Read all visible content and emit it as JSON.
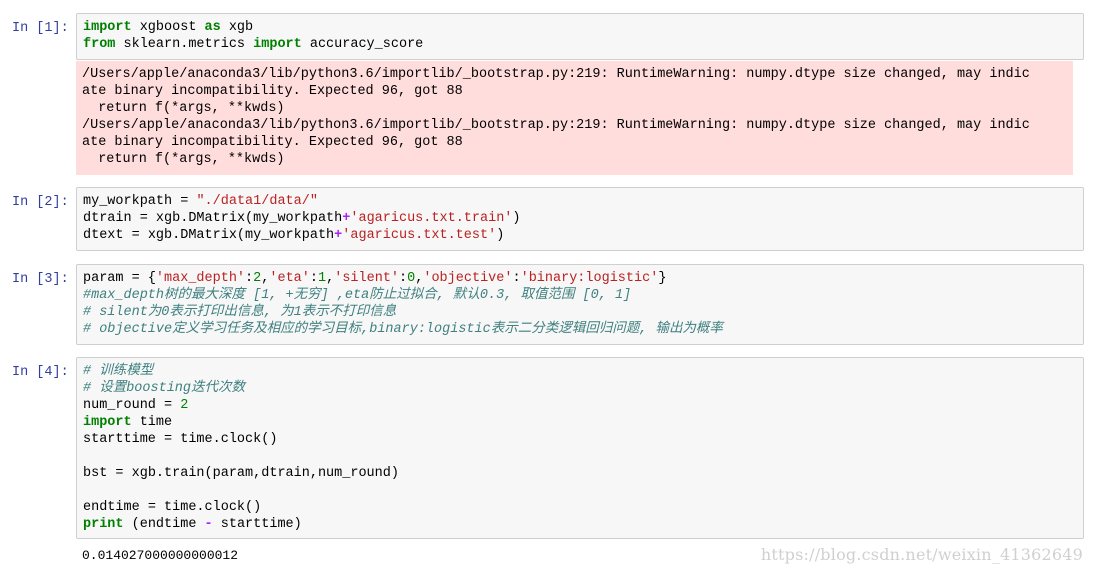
{
  "cells": [
    {
      "prompt": "In [1]:",
      "lines": [
        [
          {
            "t": "import",
            "c": "kw"
          },
          {
            "t": " xgboost ",
            "c": ""
          },
          {
            "t": "as",
            "c": "kw"
          },
          {
            "t": " xgb",
            "c": ""
          }
        ],
        [
          {
            "t": "from",
            "c": "kw"
          },
          {
            "t": " sklearn.metrics ",
            "c": ""
          },
          {
            "t": "import",
            "c": "kw"
          },
          {
            "t": " accuracy_score",
            "c": ""
          }
        ]
      ],
      "stderr": [
        "/Users/apple/anaconda3/lib/python3.6/importlib/_bootstrap.py:219: RuntimeWarning: numpy.dtype size changed, may indic",
        "ate binary incompatibility. Expected 96, got 88",
        "  return f(*args, **kwds)",
        "/Users/apple/anaconda3/lib/python3.6/importlib/_bootstrap.py:219: RuntimeWarning: numpy.dtype size changed, may indic",
        "ate binary incompatibility. Expected 96, got 88",
        "  return f(*args, **kwds)"
      ]
    },
    {
      "prompt": "In [2]:",
      "lines": [
        [
          {
            "t": "my_workpath ",
            "c": ""
          },
          {
            "t": "=",
            "c": ""
          },
          {
            "t": " ",
            "c": ""
          },
          {
            "t": "\"./data1/data/\"",
            "c": "str"
          }
        ],
        [
          {
            "t": "dtrain ",
            "c": ""
          },
          {
            "t": "=",
            "c": ""
          },
          {
            "t": " xgb.DMatrix(my_workpath",
            "c": ""
          },
          {
            "t": "+",
            "c": "op"
          },
          {
            "t": "'agaricus.txt.train'",
            "c": "str"
          },
          {
            "t": ")",
            "c": ""
          }
        ],
        [
          {
            "t": "dtext ",
            "c": ""
          },
          {
            "t": "=",
            "c": ""
          },
          {
            "t": " xgb.DMatrix(my_workpath",
            "c": ""
          },
          {
            "t": "+",
            "c": "op"
          },
          {
            "t": "'agaricus.txt.test'",
            "c": "str"
          },
          {
            "t": ")",
            "c": ""
          }
        ]
      ]
    },
    {
      "prompt": "In [3]:",
      "lines": [
        [
          {
            "t": "param ",
            "c": ""
          },
          {
            "t": "=",
            "c": ""
          },
          {
            "t": " {",
            "c": ""
          },
          {
            "t": "'max_depth'",
            "c": "str"
          },
          {
            "t": ":",
            "c": ""
          },
          {
            "t": "2",
            "c": "num"
          },
          {
            "t": ",",
            "c": ""
          },
          {
            "t": "'eta'",
            "c": "str"
          },
          {
            "t": ":",
            "c": ""
          },
          {
            "t": "1",
            "c": "num"
          },
          {
            "t": ",",
            "c": ""
          },
          {
            "t": "'silent'",
            "c": "str"
          },
          {
            "t": ":",
            "c": ""
          },
          {
            "t": "0",
            "c": "num"
          },
          {
            "t": ",",
            "c": ""
          },
          {
            "t": "'objective'",
            "c": "str"
          },
          {
            "t": ":",
            "c": ""
          },
          {
            "t": "'binary:logistic'",
            "c": "str"
          },
          {
            "t": "}",
            "c": ""
          }
        ],
        [
          {
            "t": "#max_depth树的最大深度 [1, +无穷] ,eta防止过拟合, 默认0.3, 取值范围 [0, 1]",
            "c": "cm"
          }
        ],
        [
          {
            "t": "# silent为0表示打印出信息, 为1表示不打印信息",
            "c": "cm"
          }
        ],
        [
          {
            "t": "# objective定义学习任务及相应的学习目标,binary:logistic表示二分类逻辑回归问题, 输出为概率",
            "c": "cm"
          }
        ]
      ]
    },
    {
      "prompt": "In [4]:",
      "lines": [
        [
          {
            "t": "# 训练模型",
            "c": "cm"
          }
        ],
        [
          {
            "t": "# 设置boosting迭代次数",
            "c": "cm"
          }
        ],
        [
          {
            "t": "num_round ",
            "c": ""
          },
          {
            "t": "=",
            "c": ""
          },
          {
            "t": " ",
            "c": ""
          },
          {
            "t": "2",
            "c": "num"
          }
        ],
        [
          {
            "t": "import",
            "c": "kw"
          },
          {
            "t": " time",
            "c": ""
          }
        ],
        [
          {
            "t": "starttime ",
            "c": ""
          },
          {
            "t": "=",
            "c": ""
          },
          {
            "t": " time.clock()",
            "c": ""
          }
        ],
        [],
        [
          {
            "t": "bst ",
            "c": ""
          },
          {
            "t": "=",
            "c": ""
          },
          {
            "t": " xgb.train(param,dtrain,num_round)",
            "c": ""
          }
        ],
        [],
        [
          {
            "t": "endtime ",
            "c": ""
          },
          {
            "t": "=",
            "c": ""
          },
          {
            "t": " time.clock()",
            "c": ""
          }
        ],
        [
          {
            "t": "print",
            "c": "kw"
          },
          {
            "t": " (endtime ",
            "c": ""
          },
          {
            "t": "-",
            "c": "op"
          },
          {
            "t": " starttime)",
            "c": ""
          }
        ]
      ],
      "output": "0.014027000000000012"
    }
  ],
  "watermark": "https://blog.csdn.net/weixin_41362649"
}
